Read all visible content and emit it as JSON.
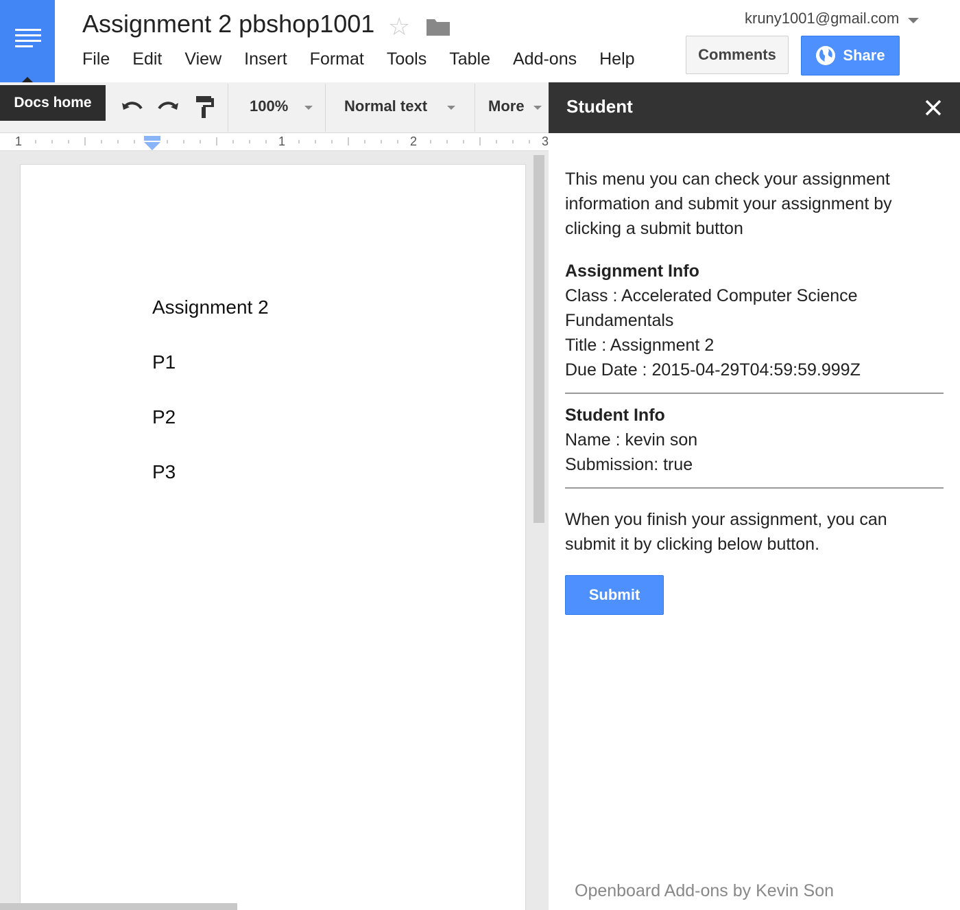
{
  "header": {
    "doc_title": "Assignment 2 pbshop1001",
    "account": "kruny1001@gmail.com",
    "comments_label": "Comments",
    "share_label": "Share",
    "menu": [
      "File",
      "Edit",
      "View",
      "Insert",
      "Format",
      "Tools",
      "Table",
      "Add-ons",
      "Help"
    ]
  },
  "toolbar": {
    "docs_home": "Docs home",
    "zoom": "100%",
    "style": "Normal text",
    "more": "More"
  },
  "ruler": {
    "marks": [
      "1",
      "1",
      "2",
      "3"
    ]
  },
  "document": {
    "lines": [
      "Assignment 2",
      "P1",
      "P2",
      "P3"
    ]
  },
  "sidebar": {
    "title": "Student",
    "intro": "This menu you can check your assignment information and submit your assignment by clicking a submit button",
    "assignment_heading": "Assignment Info",
    "class_line": "Class : Accelerated Computer Science Fundamentals",
    "title_line": "Title : Assignment 2",
    "due_line": "Due Date : 2015-04-29T04:59:59.999Z",
    "student_heading": "Student Info",
    "name_line": "Name : kevin son",
    "submission_line": "Submission: true",
    "instruction": "When you finish your assignment, you can submit it by clicking below button.",
    "submit_label": "Submit",
    "footer": "Openboard Add-ons by Kevin Son"
  },
  "colors": {
    "brand_blue": "#4285f4",
    "button_blue": "#4d90fe",
    "dark_header": "#333333"
  }
}
